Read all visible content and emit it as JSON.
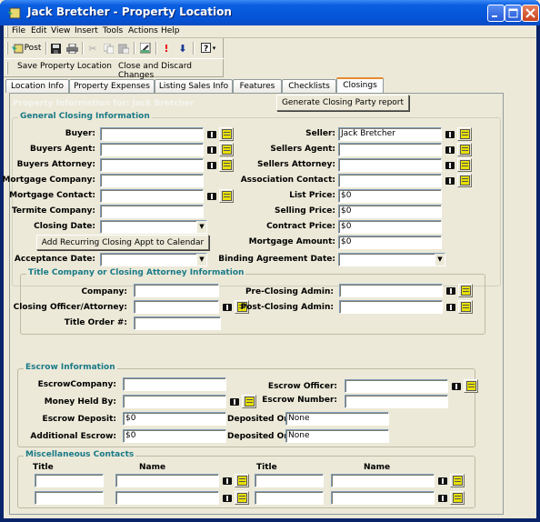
{
  "window": {
    "title": "Jack Bretcher - Property Location",
    "controls": [
      "minimize",
      "maximize",
      "close"
    ]
  },
  "menu": [
    "File",
    "Edit",
    "View",
    "Insert",
    "Tools",
    "Actions",
    "Help"
  ],
  "toolbar": {
    "post_label": "Post",
    "icons": [
      "post-icon",
      "save-icon",
      "print-icon",
      "cut-icon",
      "copy-icon",
      "paste-icon",
      "edit-form-icon",
      "importance-high-icon",
      "importance-low-icon",
      "help-icon"
    ]
  },
  "actions": {
    "save": "Save Property Location",
    "close": "Close and Discard Changes"
  },
  "tabs": [
    {
      "label": "Location Info",
      "active": false
    },
    {
      "label": "Property Expenses",
      "active": false
    },
    {
      "label": "Listing Sales Info",
      "active": false
    },
    {
      "label": "Features",
      "active": false
    },
    {
      "label": "Checklists",
      "active": false
    },
    {
      "label": "Closings",
      "active": true
    }
  ],
  "panel": {
    "heading": "Property Information for: Jack Bretcher",
    "generate_button": "Generate Closing Party report"
  },
  "general": {
    "title": "General Closing Information",
    "left": {
      "buyer": {
        "label": "Buyer:",
        "value": ""
      },
      "buyers_agent": {
        "label": "Buyers Agent:",
        "value": ""
      },
      "buyers_attorney": {
        "label": "Buyers Attorney:",
        "value": ""
      },
      "mortgage_company": {
        "label": "Mortgage Company:",
        "value": ""
      },
      "mortgage_contact": {
        "label": "Mortgage Contact:",
        "value": ""
      },
      "termite_company": {
        "label": "Termite Company:",
        "value": ""
      },
      "closing_date": {
        "label": "Closing Date:",
        "value": ""
      },
      "add_recurring": "Add Recurring Closing Appt to Calendar",
      "acceptance_date": {
        "label": "Acceptance Date:",
        "value": ""
      }
    },
    "right": {
      "seller": {
        "label": "Seller:",
        "value": "Jack Bretcher"
      },
      "sellers_agent": {
        "label": "Sellers Agent:",
        "value": ""
      },
      "sellers_attorney": {
        "label": "Sellers Attorney:",
        "value": ""
      },
      "association_contact": {
        "label": "Association Contact:",
        "value": ""
      },
      "list_price": {
        "label": "List Price:",
        "value": "$0"
      },
      "selling_price": {
        "label": "Selling Price:",
        "value": "$0"
      },
      "contract_price": {
        "label": "Contract Price:",
        "value": "$0"
      },
      "mortgage_amount": {
        "label": "Mortgage Amount:",
        "value": "$0"
      },
      "binding_date": {
        "label": "Binding Agreement Date:",
        "value": ""
      }
    }
  },
  "title_company": {
    "title": "Title Company or Closing Attorney Information",
    "company": {
      "label": "Company:",
      "value": ""
    },
    "closing_officer": {
      "label": "Closing Officer/Attorney:",
      "value": ""
    },
    "title_order": {
      "label": "Title Order #:",
      "value": ""
    },
    "pre_closing": {
      "label": "Pre-Closing Admin:",
      "value": ""
    },
    "post_closing": {
      "label": "Post-Closing Admin:",
      "value": ""
    }
  },
  "escrow": {
    "title": "Escrow Information",
    "company": {
      "label": "EscrowCompany:",
      "value": ""
    },
    "money_held_by": {
      "label": "Money Held By:",
      "value": ""
    },
    "deposit": {
      "label": "Escrow Deposit:",
      "value": "$0"
    },
    "additional": {
      "label": "Additional Escrow:",
      "value": "$0"
    },
    "deposited_on_1": {
      "label": "Deposited On:",
      "value": "None"
    },
    "deposited_on_2": {
      "label": "Deposited On:",
      "value": "None"
    },
    "officer": {
      "label": "Escrow Officer:",
      "value": ""
    },
    "number": {
      "label": "Escrow Number:",
      "value": ""
    }
  },
  "misc": {
    "title": "Miscellaneous Contacts",
    "col_title": "Title",
    "col_name": "Name",
    "rows": [
      {
        "title1": "",
        "name1": "",
        "title2": "",
        "name2": ""
      },
      {
        "title1": "",
        "name1": "",
        "title2": "",
        "name2": ""
      }
    ]
  }
}
